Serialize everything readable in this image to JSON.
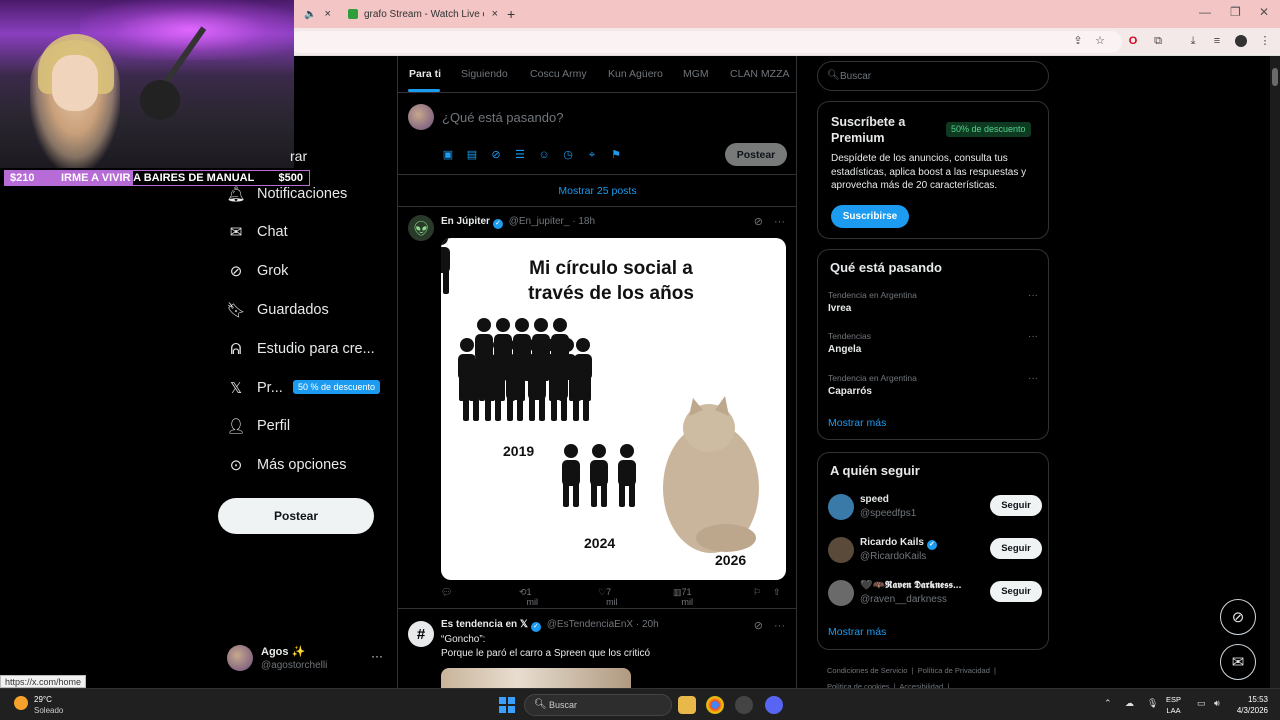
{
  "browser": {
    "tabs": [
      {
        "label": "",
        "close": "×"
      },
      {
        "label": "grafo Stream - Watch Live on K",
        "close": "×"
      }
    ],
    "new_tab": "+",
    "status_url": "https://x.com/home"
  },
  "stream_overlay": {
    "amount_left": "$210",
    "goal_text": "IRME A VIVIR A BAIRES DE MANUAL",
    "amount_right": "$500",
    "progress": 0.42
  },
  "sidebar": {
    "partial_label": "rar",
    "items": [
      {
        "label": "Notificaciones",
        "icon": "bell-icon"
      },
      {
        "label": "Chat",
        "icon": "envelope-icon"
      },
      {
        "label": "Grok",
        "icon": "grok-icon"
      },
      {
        "label": "Guardados",
        "icon": "bookmark-icon"
      },
      {
        "label": "Estudio para cre...",
        "icon": "studio-icon"
      },
      {
        "label": "Pr...",
        "icon": "x-logo-icon"
      },
      {
        "label": "Perfil",
        "icon": "person-icon"
      },
      {
        "label": "Más opciones",
        "icon": "more-circle-icon"
      }
    ],
    "premium_badge": "50 % de descuento",
    "post_button": "Postear",
    "account": {
      "name": "Agos ✨",
      "handle": "@agostorchelli",
      "more": "···"
    }
  },
  "timeline": {
    "tabs": [
      {
        "label": "Para ti",
        "active": true
      },
      {
        "label": "Siguiendo",
        "active": false
      },
      {
        "label": "Coscu Army",
        "active": false
      },
      {
        "label": "Kun Agüero",
        "active": false
      },
      {
        "label": "MGM",
        "active": false
      },
      {
        "label": "CLAN MZZA",
        "active": false
      }
    ],
    "composer_placeholder": "¿Qué está pasando?",
    "composer_post_button": "Postear",
    "show_more": "Mostrar 25 posts",
    "post1": {
      "name": "En Júpiter",
      "handle": "@En_jupiter_",
      "time": "· 18h",
      "meme_title": "Mi círculo social a través de los años",
      "years": [
        "2019",
        "2024",
        "2026"
      ],
      "reposts": "1 mil",
      "likes": "7 mil",
      "views": "71 mil"
    },
    "post2": {
      "name": "Es tendencia en 𝕏",
      "handle": "@EsTendenciaEnX",
      "time": "· 20h",
      "line1": "“Goncho”:",
      "line2": "Porque le paró el carro a Spreen que los criticó"
    }
  },
  "right": {
    "search_placeholder": "Buscar",
    "premium": {
      "title": "Suscríbete a Premium",
      "badge": "50% de descuento",
      "description": "Despídete de los anuncios, consulta tus estadísticas, aplica boost a las respuestas y aprovecha más de 20 características.",
      "button": "Suscribirse"
    },
    "trends": {
      "title": "Qué está pasando",
      "items": [
        {
          "context": "Tendencia en Argentina",
          "topic": "Ivrea"
        },
        {
          "context": "Tendencias",
          "topic": "Angela"
        },
        {
          "context": "Tendencia en Argentina",
          "topic": "Caparrós"
        }
      ],
      "show_more": "Mostrar más"
    },
    "follow": {
      "title": "A quién seguir",
      "items": [
        {
          "name": "speed",
          "handle": "@speedfps1",
          "button": "Seguir",
          "avatar_color": "#3a7aa8"
        },
        {
          "name": "Ricardo Kails",
          "handle": "@RicardoKails",
          "button": "Seguir",
          "avatar_color": "#5a4a3a"
        },
        {
          "name": "🖤🦇𝕽𝖆𝖛𝖊𝖓 𝕯𝖆𝖗𝖐𝖓𝖊𝖘𝖘...",
          "handle": "@raven__darkness",
          "button": "Seguir",
          "avatar_color": "#6a6a6a"
        }
      ],
      "show_more": "Mostrar más"
    },
    "footer": {
      "links": [
        "Condiciones de Servicio",
        "Política de Privacidad",
        "Política de cookies",
        "Accesibilidad"
      ]
    }
  },
  "taskbar": {
    "temperature": "29°C",
    "condition": "Soleado",
    "search_label": "Buscar",
    "lang_top": "ESP",
    "lang_bottom": "LAA",
    "time": "15:53",
    "date": "4/3/2026"
  }
}
